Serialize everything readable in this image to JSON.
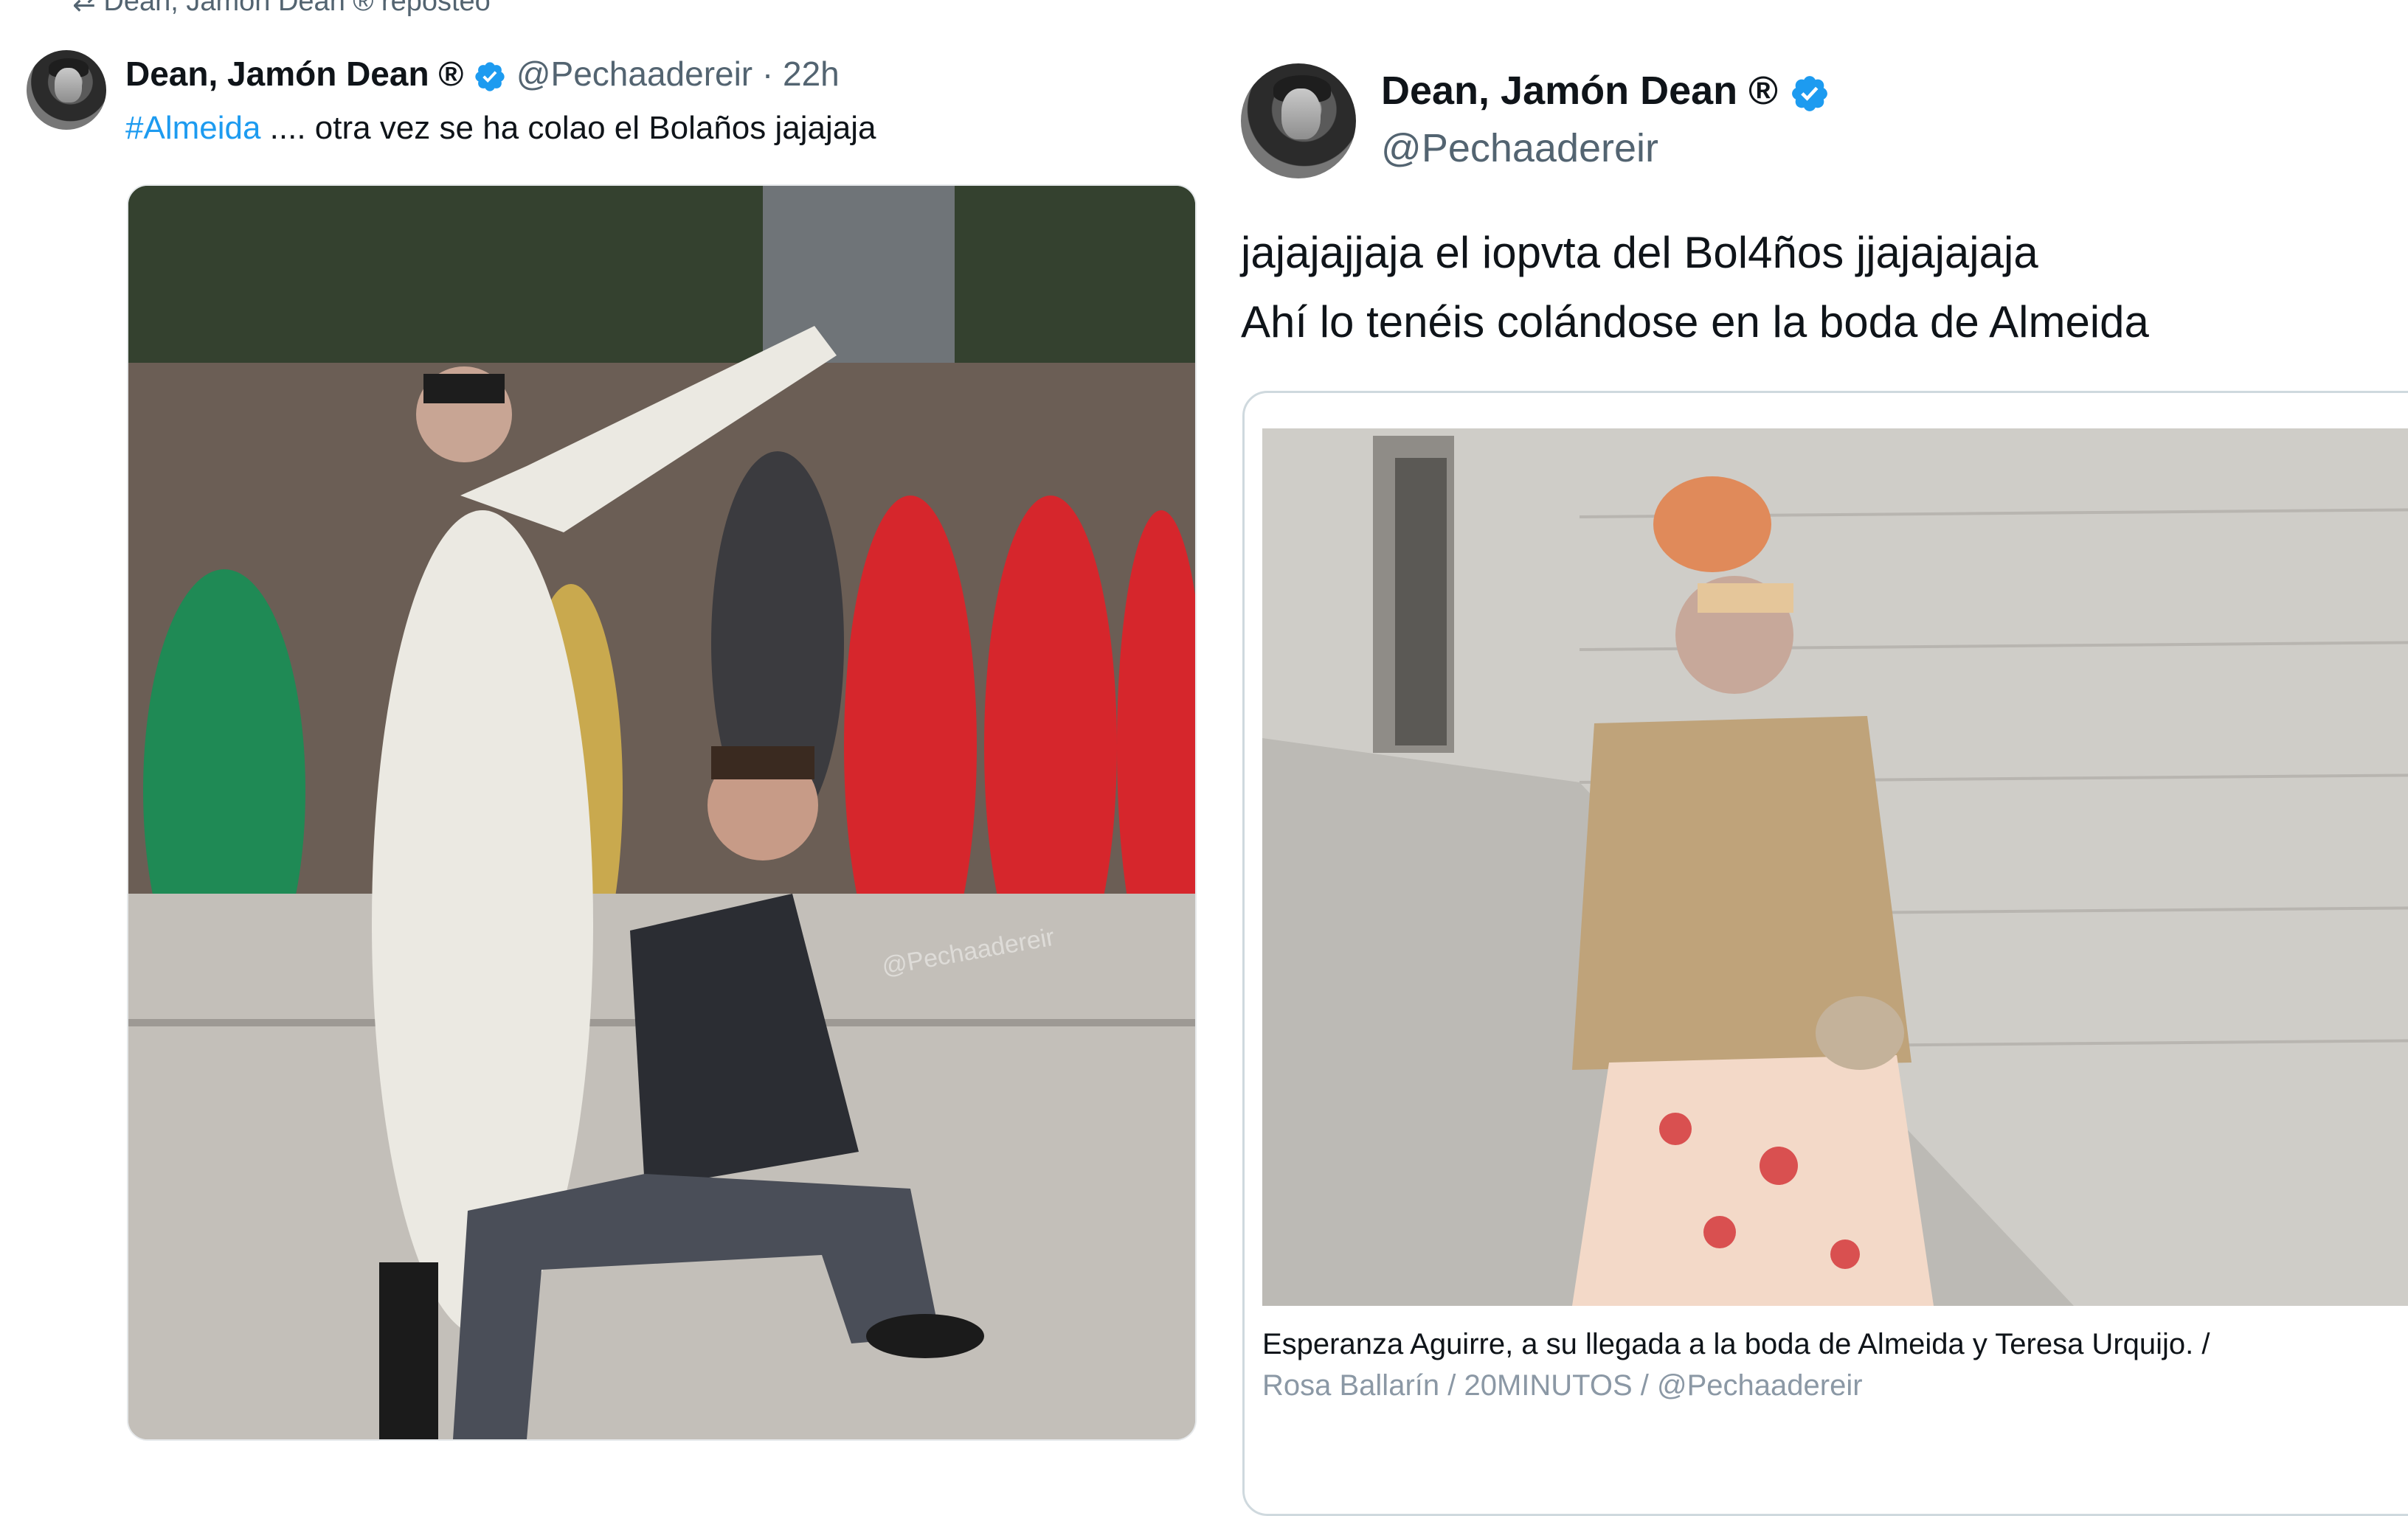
{
  "left_tweet": {
    "repost_text": "Dean, Jamón Dean ® reposteó",
    "author_name": "Dean, Jamón Dean ®",
    "handle": "@Pechaadereir",
    "time": "· 22h",
    "hashtag": "#Almeida",
    "text": " .... otra vez se ha colao el Bolaños jajajaja",
    "photo_watermark": "@Pechaadereir"
  },
  "right_tweet": {
    "author_name": "Dean, Jamón Dean ®",
    "handle": "@Pechaadereir",
    "text_line1": "jajajajjaja el iopvta del Bol4ños jjajajajaja",
    "text_line2": "Ahí lo tenéis colándose en la boda de Almeida",
    "caption_line1": "Esperanza Aguirre, a su llegada a la boda de Almeida y Teresa Urquijo. /",
    "caption_line2": "Rosa Ballarín / 20MINUTOS / @Pechaadereir"
  },
  "colors": {
    "verified": "#1d9bf0",
    "hashtag": "#1d9bf0",
    "secondary_text": "#536471"
  },
  "icons": [
    "repost-icon",
    "verified-badge-icon"
  ]
}
